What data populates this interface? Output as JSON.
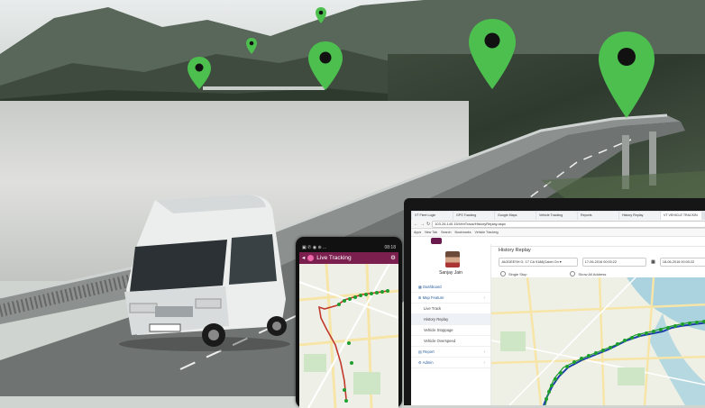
{
  "phone": {
    "status_left": "▣ ✆ ◉ ⊕ ...",
    "status_right": "08:18",
    "app_title": "Live Tracking",
    "icons": {
      "back": "back-arrow-icon",
      "settings": "gear-icon",
      "logo": "app-logo-icon"
    }
  },
  "browser": {
    "tabs": [
      "VT Fleet Login",
      "GPS Tracking",
      "Google Maps",
      "Vehicle Tracking",
      "Reports",
      "History Replay",
      "VT VEHICLE TRACKIN"
    ],
    "url": "103.26.140.15/VehTrack/HistoryReplay.aspx",
    "bookmarks": [
      "Apps",
      "New Tab",
      "Search",
      "Bookmarks",
      "Vehicle Tracking"
    ],
    "nav_icons": [
      "back-arrow-icon",
      "forward-arrow-icon",
      "reload-icon"
    ]
  },
  "sidebar": {
    "user_name": "Sanjay Jain",
    "items": [
      {
        "label": "Dashboard",
        "icon": "dashboard-icon",
        "sub": false
      },
      {
        "label": "Map Feature",
        "icon": "map-icon",
        "sub": false,
        "chevron": "‹"
      },
      {
        "label": "Live Track",
        "sub": true
      },
      {
        "label": "History Replay",
        "sub": true,
        "active": true
      },
      {
        "label": "Vehicle Stoppage",
        "sub": true
      },
      {
        "label": "Vehicle Overspeed",
        "sub": true
      },
      {
        "label": "Report",
        "icon": "report-icon",
        "sub": false,
        "chevron": "‹"
      },
      {
        "label": "Admin",
        "icon": "admin-icon",
        "sub": false,
        "chevron": "‹"
      }
    ]
  },
  "main": {
    "title": "History Replay",
    "vehicle_select": "JAGDEESH G. 17 CA 9188(Cabin On ▾",
    "from_date": "17-06-2016 00:00:22",
    "to_date": "18-06-2016 00:00:22",
    "radio_single": "Single Stop",
    "radio_show_all": "Show All Address"
  },
  "colors": {
    "pin": "#4cbf4f",
    "app_bar": "#7b1f4f",
    "route_green": "#1f9e2f",
    "route_red": "#c0392b",
    "route_blue": "#1d3fa8",
    "menu_text": "#2a5d9c"
  }
}
